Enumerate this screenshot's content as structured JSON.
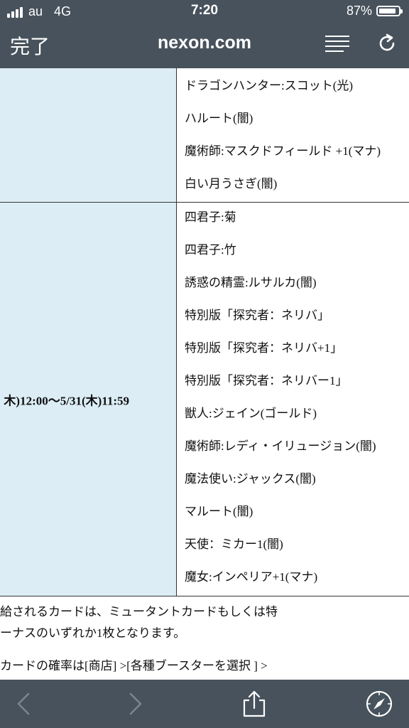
{
  "status_bar": {
    "carrier": "au",
    "network": "4G",
    "time": "7:20",
    "battery_percent": "87%",
    "battery_level": 0.87
  },
  "nav_bar": {
    "done_label": "完了",
    "domain": "nexon.com"
  },
  "table": {
    "rows": [
      {
        "date_range": "",
        "cards": [
          "ドラゴンハンター:スコット(光)",
          "ハルート(闇)",
          "魔術師:マスクドフィールド +1(マナ)",
          "白い月うさぎ(闇)"
        ]
      },
      {
        "date_range": "木)12:00〜5/31(木)11:59",
        "cards": [
          "四君子:菊",
          "四君子:竹",
          "誘惑の精霊:ルサルカ(闇)",
          "特別版「探究者：ネリバ」",
          "特別版「探究者：ネリバ+1」",
          "特別版「探究者：ネリバー1」",
          "獣人:ジェイン(ゴールド)",
          "魔術師:レディ・イリュージョン(闇)",
          "魔法使い:ジャックス(闇)",
          "マルート(闇)",
          "天使：ミカー1(闇)",
          "魔女:インペリア+1(マナ)"
        ]
      }
    ]
  },
  "notes": [
    "給されるカードは、ミュータントカードもしくは特",
    "ーナスのいずれか1枚となります。",
    "カードの確率は[商店] >[各種ブースターを選択 ] >"
  ],
  "toolbar": {
    "back_icon": "chevron-left-icon",
    "forward_icon": "chevron-right-icon",
    "share_icon": "share-icon",
    "safari_icon": "compass-icon"
  }
}
